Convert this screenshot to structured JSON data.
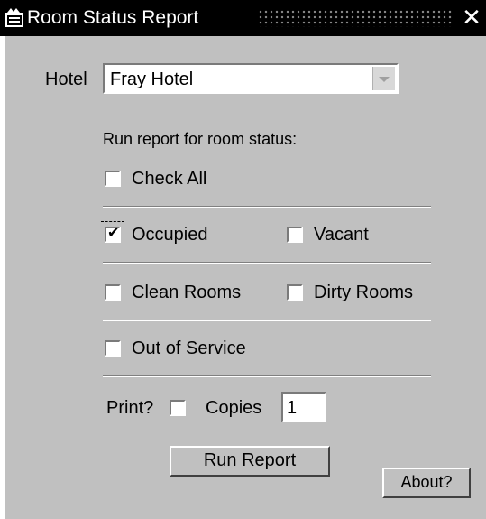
{
  "window": {
    "title": "Room Status Report",
    "app_icon": "forms-app-icon",
    "close_icon": "close-icon",
    "close_glyph": "✕"
  },
  "hotel": {
    "label": "Hotel",
    "value": "Fray Hotel"
  },
  "report": {
    "heading": "Run report for room status:",
    "check_all": {
      "label": "Check All",
      "checked": false
    },
    "occupied": {
      "label": "Occupied",
      "checked": true
    },
    "vacant": {
      "label": "Vacant",
      "checked": false
    },
    "clean_rooms": {
      "label": "Clean Rooms",
      "checked": false
    },
    "dirty_rooms": {
      "label": "Dirty Rooms",
      "checked": false
    },
    "out_of_service": {
      "label": "Out of Service",
      "checked": false
    }
  },
  "print": {
    "label": "Print?",
    "checked": false,
    "copies_label": "Copies",
    "copies_value": "1"
  },
  "buttons": {
    "run_report": "Run Report",
    "about": "About?"
  },
  "check_glyph": "✔",
  "colors": {
    "titlebar_bg": "#000000",
    "dialog_bg": "#c0c0c0",
    "field_bg": "#ffffff"
  }
}
